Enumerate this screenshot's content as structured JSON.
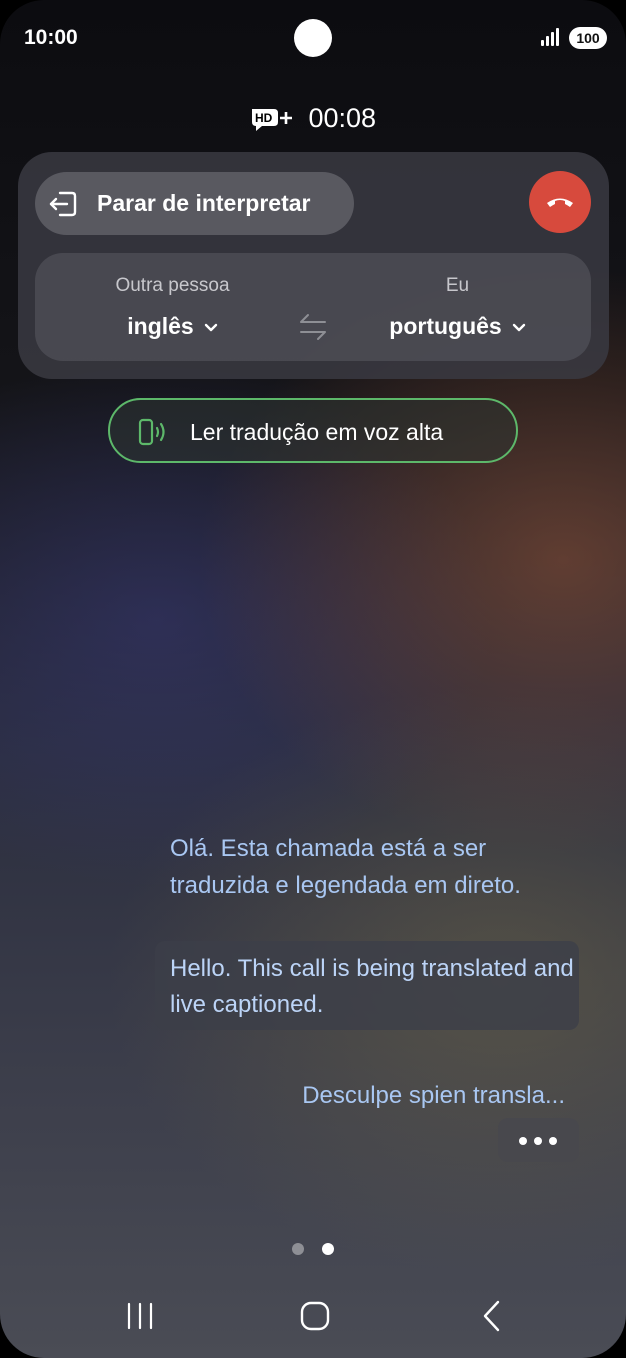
{
  "status_bar": {
    "time": "10:00",
    "battery": "100"
  },
  "call": {
    "hd_badge": "HD+",
    "timer": "00:08"
  },
  "interpreter": {
    "stop_label": "Parar de interpretar",
    "other_person_label": "Outra pessoa",
    "other_person_language": "inglês",
    "me_label": "Eu",
    "me_language": "português",
    "read_aloud_label": "Ler tradução em voz alta"
  },
  "transcript": {
    "original": "Olá. Esta chamada está a ser traduzida e legendada em direto.",
    "translated": "Hello. This call is being translated and live captioned.",
    "pending": "Desculpe spien transla..."
  },
  "colors": {
    "end_call": "#d74a3d",
    "read_aloud_accent": "#5db86a",
    "caption_text": "#a9c7f2"
  },
  "icons": [
    "hd-plus-icon",
    "exit-icon",
    "end-call-icon",
    "chevron-down-icon",
    "swap-icon",
    "speaker-phone-icon",
    "more-icon",
    "recent-apps-icon",
    "home-icon",
    "back-icon"
  ],
  "pager": {
    "pages": 2,
    "current": 2
  }
}
